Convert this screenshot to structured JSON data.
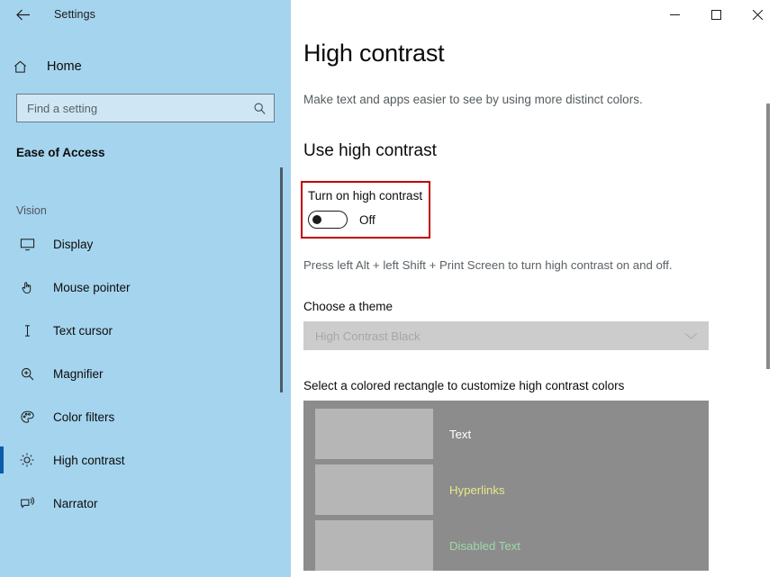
{
  "window": {
    "app_title": "Settings",
    "back_icon": "back-arrow-icon",
    "minimize_label": "—",
    "maximize_label": "☐",
    "close_label": "✕"
  },
  "sidebar": {
    "home_label": "Home",
    "home_icon": "home-icon",
    "search": {
      "placeholder": "Find a setting",
      "value": "",
      "icon": "search-icon"
    },
    "category": "Ease of Access",
    "group_label": "Vision",
    "items": [
      {
        "label": "Display",
        "icon": "monitor-icon"
      },
      {
        "label": "Mouse pointer",
        "icon": "hand-pointer-icon"
      },
      {
        "label": "Text cursor",
        "icon": "text-cursor-icon"
      },
      {
        "label": "Magnifier",
        "icon": "magnifier-icon"
      },
      {
        "label": "Color filters",
        "icon": "palette-icon"
      },
      {
        "label": "High contrast",
        "icon": "brightness-icon"
      },
      {
        "label": "Narrator",
        "icon": "narrator-icon"
      }
    ],
    "selected_index": 5,
    "accent_color": "#0a5ca8",
    "background_color": "#a5d4ee"
  },
  "main": {
    "page_title": "High contrast",
    "page_description": "Make text and apps easier to see by using more distinct colors.",
    "section_title": "Use high contrast",
    "toggle": {
      "label": "Turn on high contrast",
      "state": "Off",
      "checked": false,
      "highlight_color": "#c00000"
    },
    "shortcut_hint": "Press left Alt + left Shift + Print Screen to turn high contrast on and off.",
    "theme": {
      "label": "Choose a theme",
      "selected": "High Contrast Black",
      "disabled": true,
      "chevron_icon": "chevron-down-icon"
    },
    "swatches": {
      "intro": "Select a colored rectangle to customize high contrast colors",
      "panel_color": "#8c8c8c",
      "chip_color": "#b6b6b6",
      "rows": [
        {
          "name": "Text",
          "text_color": "#ffffff"
        },
        {
          "name": "Hyperlinks",
          "text_color": "#e8e88a"
        },
        {
          "name": "Disabled Text",
          "text_color": "#9fd8a8"
        }
      ]
    }
  }
}
